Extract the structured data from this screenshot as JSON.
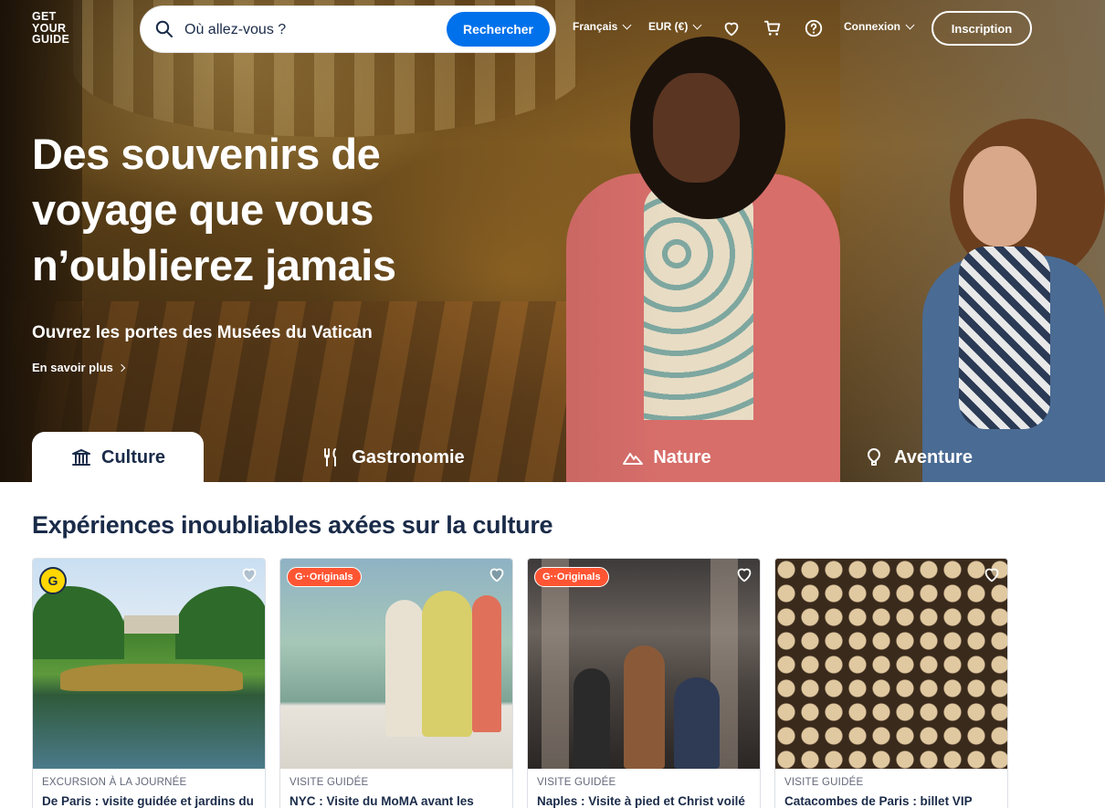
{
  "header": {
    "logo_lines": [
      "GET",
      "YOUR",
      "GUIDE"
    ],
    "search_placeholder": "Où allez-vous ?",
    "search_button": "Rechercher",
    "language": "Français",
    "currency": "EUR (€)",
    "login": "Connexion",
    "signup": "Inscription",
    "icons": [
      "heart-icon",
      "cart-icon",
      "help-icon"
    ]
  },
  "hero": {
    "title": "Des souvenirs de voyage que vous n’oublierez jamais",
    "subtitle": "Ouvrez les portes des Musées du Vatican",
    "link": "En savoir plus"
  },
  "tabs": [
    {
      "label": "Culture",
      "icon": "museum-icon",
      "active": true
    },
    {
      "label": "Gastronomie",
      "icon": "fork-knife-icon",
      "active": false
    },
    {
      "label": "Nature",
      "icon": "mountain-icon",
      "active": false
    },
    {
      "label": "Aventure",
      "icon": "balloon-icon",
      "active": false
    }
  ],
  "section": {
    "title": "Expériences inoubliables axées sur la culture",
    "cards": [
      {
        "category": "EXCURSION À LA JOURNÉE",
        "title": "De Paris : visite guidée et jardins du",
        "badge": "G"
      },
      {
        "category": "VISITE GUIDÉE",
        "title": "NYC : Visite du MoMA avant les",
        "badge": "G··Originals"
      },
      {
        "category": "VISITE GUIDÉE",
        "title": "Naples : Visite à pied et Christ voilé",
        "badge": "G··Originals"
      },
      {
        "category": "VISITE GUIDÉE",
        "title": "Catacombes de Paris : billet VIP",
        "badge": ""
      }
    ]
  },
  "colors": {
    "brand_blue": "#0071eb",
    "text_navy": "#1a2b49",
    "originals_orange": "#ff5533"
  }
}
